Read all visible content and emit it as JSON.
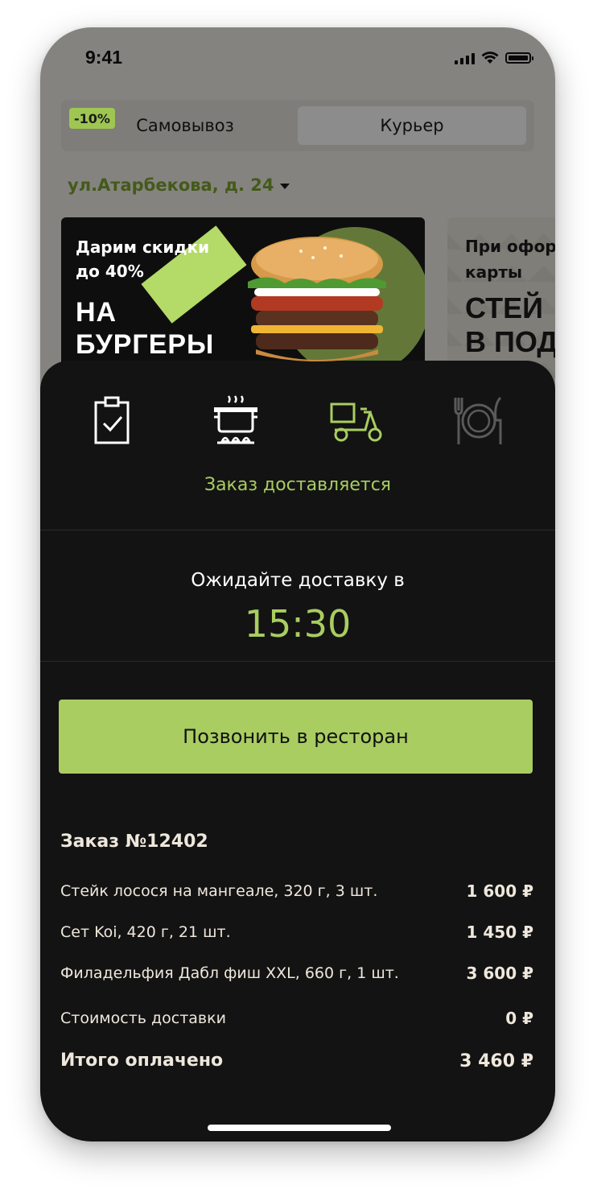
{
  "status_bar": {
    "time": "9:41"
  },
  "delivery_mode": {
    "discount_badge": "-10%",
    "pickup_label": "Самовывоз",
    "courier_label": "Курьер"
  },
  "address": {
    "label": "ул.Атарбекова, д. 24"
  },
  "promos": [
    {
      "subtitle_line1": "Дарим скидки",
      "subtitle_line2": "до 40%",
      "title_line1": "НА",
      "title_line2": "БУРГЕРЫ"
    },
    {
      "subtitle_line1": "При офор",
      "subtitle_line2": "карты",
      "title_line1": "СТЕЙ",
      "title_line2": "В ПОД"
    }
  ],
  "order_tracking": {
    "steps": [
      {
        "icon": "clipboard-check-icon",
        "state": "done"
      },
      {
        "icon": "cooking-pot-icon",
        "state": "done"
      },
      {
        "icon": "delivery-scooter-icon",
        "state": "active"
      },
      {
        "icon": "plate-cutlery-icon",
        "state": "pending"
      }
    ],
    "status_text": "Заказ доставляется",
    "wait_label": "Ожидайте доставку в",
    "eta_time": "15:30",
    "call_button": "Позвонить в ресторан"
  },
  "order": {
    "title": "Заказ №12402",
    "items": [
      {
        "name": "Стейк лосося на мангеале, 320 г, 3 шт.",
        "price": "1 600 ₽"
      },
      {
        "name": "Сет Koi, 420 г, 21 шт.",
        "price": "1 450 ₽"
      },
      {
        "name": "Филадельфия Дабл фиш XXL, 660 г, 1 шт.",
        "price": "3 600 ₽"
      }
    ],
    "delivery_cost_label": "Стоимость доставки",
    "delivery_cost": "0 ₽",
    "total_label": "Итого оплачено",
    "total": "3 460 ₽"
  },
  "colors": {
    "accent": "#a9cd61",
    "sheet_bg": "#131313",
    "text_light": "#eee7dc"
  }
}
